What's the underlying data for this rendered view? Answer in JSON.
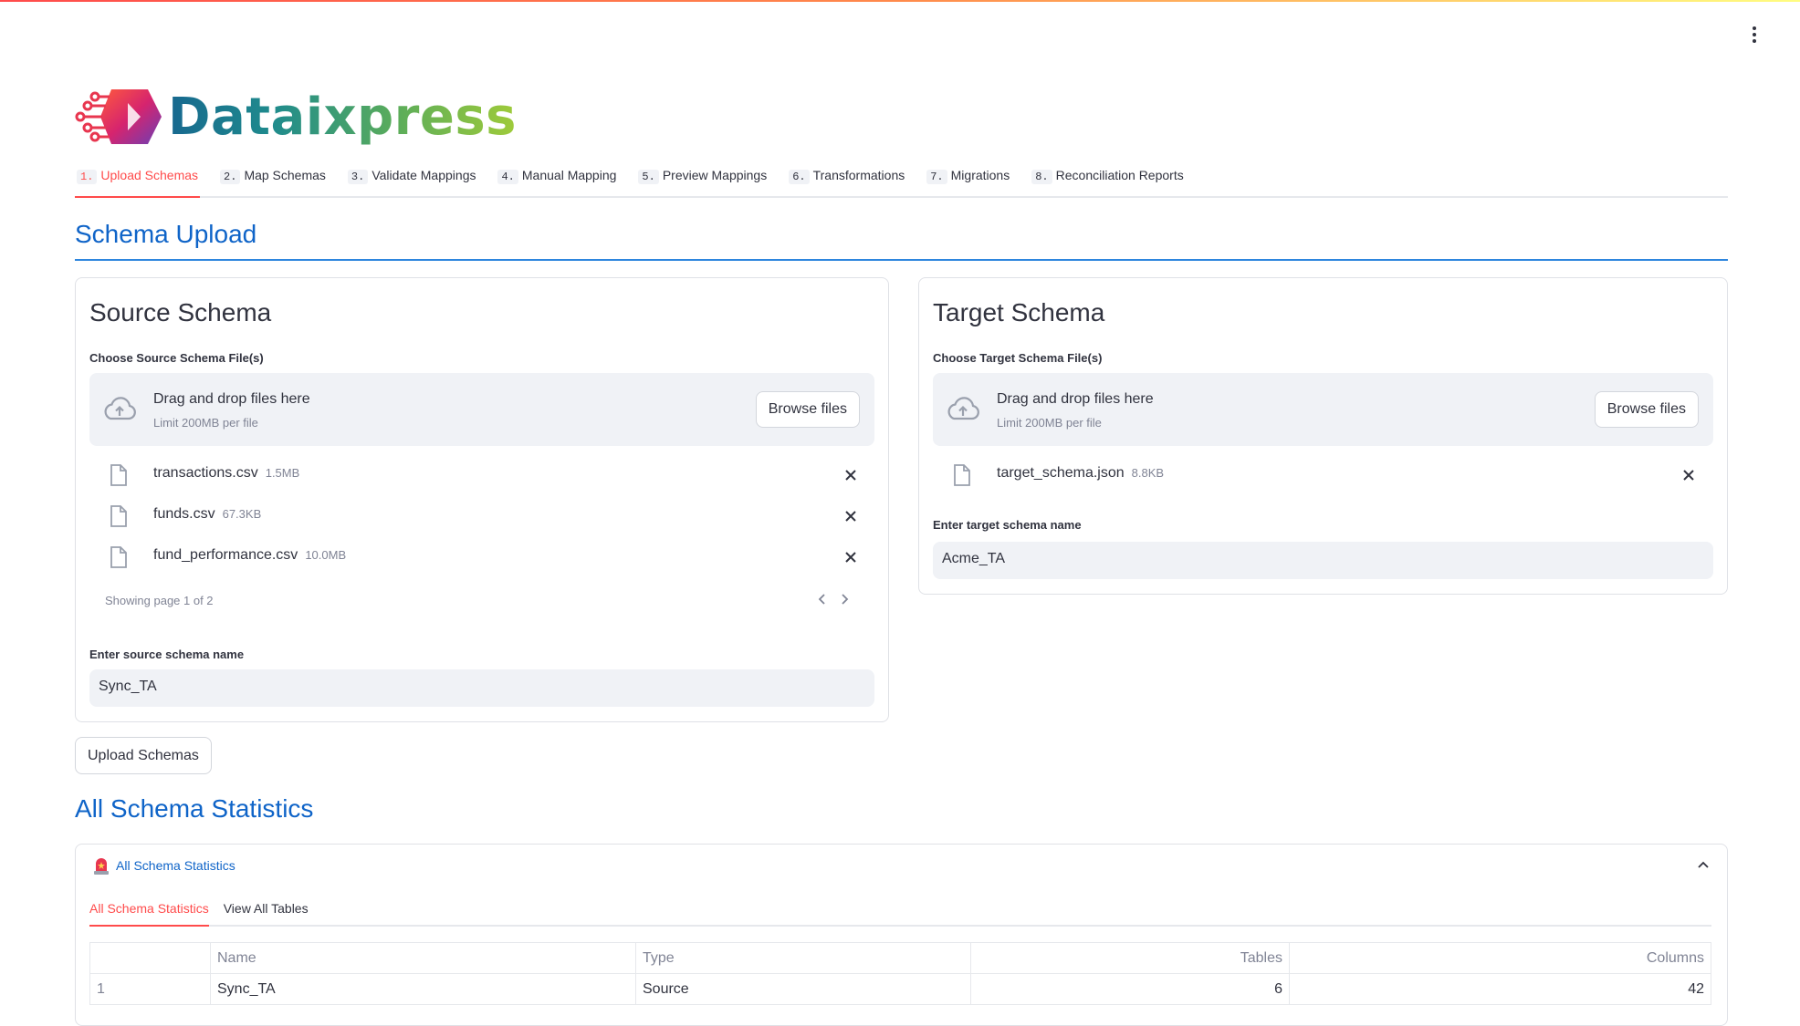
{
  "app": {
    "logo_text": "Dataixpress",
    "brand_colors": {
      "primary": "#0f64c8",
      "accent": "#ff4b4b",
      "logo_teal": "#17688f",
      "logo_green": "#9fcb3a"
    }
  },
  "nav": {
    "tabs": [
      {
        "num": "1.",
        "label": "Upload Schemas",
        "active": true
      },
      {
        "num": "2.",
        "label": "Map Schemas"
      },
      {
        "num": "3.",
        "label": "Validate Mappings"
      },
      {
        "num": "4.",
        "label": "Manual Mapping"
      },
      {
        "num": "5.",
        "label": "Preview Mappings"
      },
      {
        "num": "6.",
        "label": "Transformations"
      },
      {
        "num": "7.",
        "label": "Migrations"
      },
      {
        "num": "8.",
        "label": "Reconciliation Reports"
      }
    ]
  },
  "schema_upload": {
    "title": "Schema Upload",
    "source": {
      "title": "Source Schema",
      "uploader_label": "Choose Source Schema File(s)",
      "drop_text": "Drag and drop files here",
      "limit_text": "Limit 200MB per file",
      "browse_label": "Browse files",
      "files": [
        {
          "name": "transactions.csv",
          "size": "1.5MB"
        },
        {
          "name": "funds.csv",
          "size": "67.3KB"
        },
        {
          "name": "fund_performance.csv",
          "size": "10.0MB"
        }
      ],
      "pagination_text": "Showing page 1 of 2",
      "name_label": "Enter source schema name",
      "name_value": "Sync_TA"
    },
    "target": {
      "title": "Target Schema",
      "uploader_label": "Choose Target Schema File(s)",
      "drop_text": "Drag and drop files here",
      "limit_text": "Limit 200MB per file",
      "browse_label": "Browse files",
      "files": [
        {
          "name": "target_schema.json",
          "size": "8.8KB"
        }
      ],
      "name_label": "Enter target schema name",
      "name_value": "Acme_TA"
    },
    "upload_button": "Upload Schemas"
  },
  "statistics": {
    "title": "All Schema Statistics",
    "expander_label": "All Schema Statistics",
    "expander_icon": "siren-icon",
    "tabs": [
      {
        "label": "All Schema Statistics",
        "active": true
      },
      {
        "label": "View All Tables"
      }
    ],
    "table": {
      "columns": [
        "",
        "Name",
        "Type",
        "Tables",
        "Columns"
      ],
      "rows": [
        {
          "index": "1",
          "name": "Sync_TA",
          "type": "Source",
          "tables": "6",
          "columns": "42"
        }
      ]
    }
  }
}
